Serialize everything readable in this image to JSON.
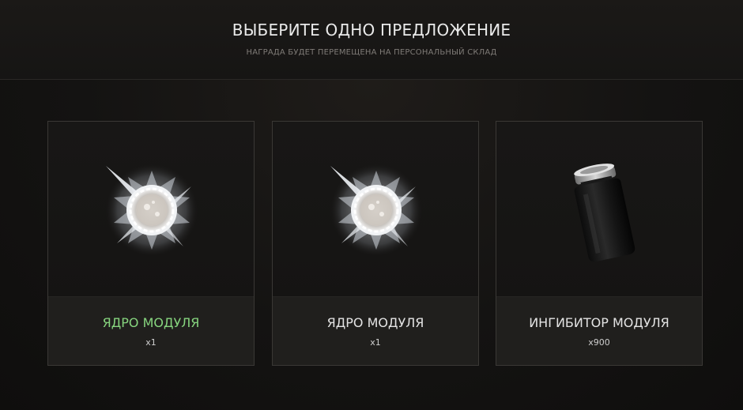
{
  "header": {
    "title": "ВЫБЕРИТЕ ОДНО ПРЕДЛОЖЕНИЕ",
    "subtitle": "НАГРАДА БУДЕТ ПЕРЕМЕЩЕНА НА ПЕРСОНАЛЬНЫЙ СКЛАД"
  },
  "offers": [
    {
      "name": "ЯДРО МОДУЛЯ",
      "qty": "x1",
      "icon": "module-core-icon",
      "selected": true
    },
    {
      "name": "ЯДРО МОДУЛЯ",
      "qty": "x1",
      "icon": "module-core-icon",
      "selected": false
    },
    {
      "name": "ИНГИБИТОР МОДУЛЯ",
      "qty": "x900",
      "icon": "inhibitor-vial-icon",
      "selected": false
    }
  ],
  "colors": {
    "selected_name": "#86d47e",
    "card_border": "#3a3835",
    "footer_bg": "#201f1d"
  }
}
